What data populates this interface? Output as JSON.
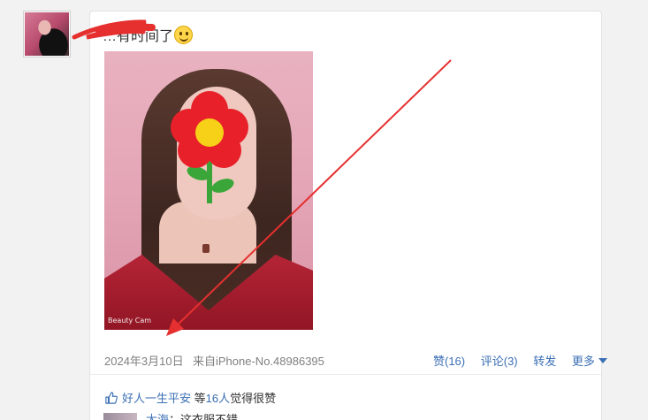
{
  "post": {
    "text": "…有时间了",
    "emoji_icon": "smiley-face-icon"
  },
  "photo": {
    "watermark": "Beauty Cam"
  },
  "meta": {
    "date": "2024年3月10日",
    "source": "来自iPhone-No.48986395"
  },
  "actions": {
    "like": "赞(16)",
    "comment": "评论(3)",
    "repost": "转发",
    "more": "更多"
  },
  "likes": {
    "name": "好人一生平安",
    "prefix": "等",
    "count": "16人",
    "suffix": "觉得很赞"
  },
  "comment": {
    "author": "大海",
    "text": "：这衣服不错"
  },
  "colors": {
    "link": "#3b6fb5",
    "annotation_red": "#e5302f",
    "flower_petal": "#e8202a",
    "flower_center": "#f7d118",
    "flower_stem": "#3aa63a"
  }
}
